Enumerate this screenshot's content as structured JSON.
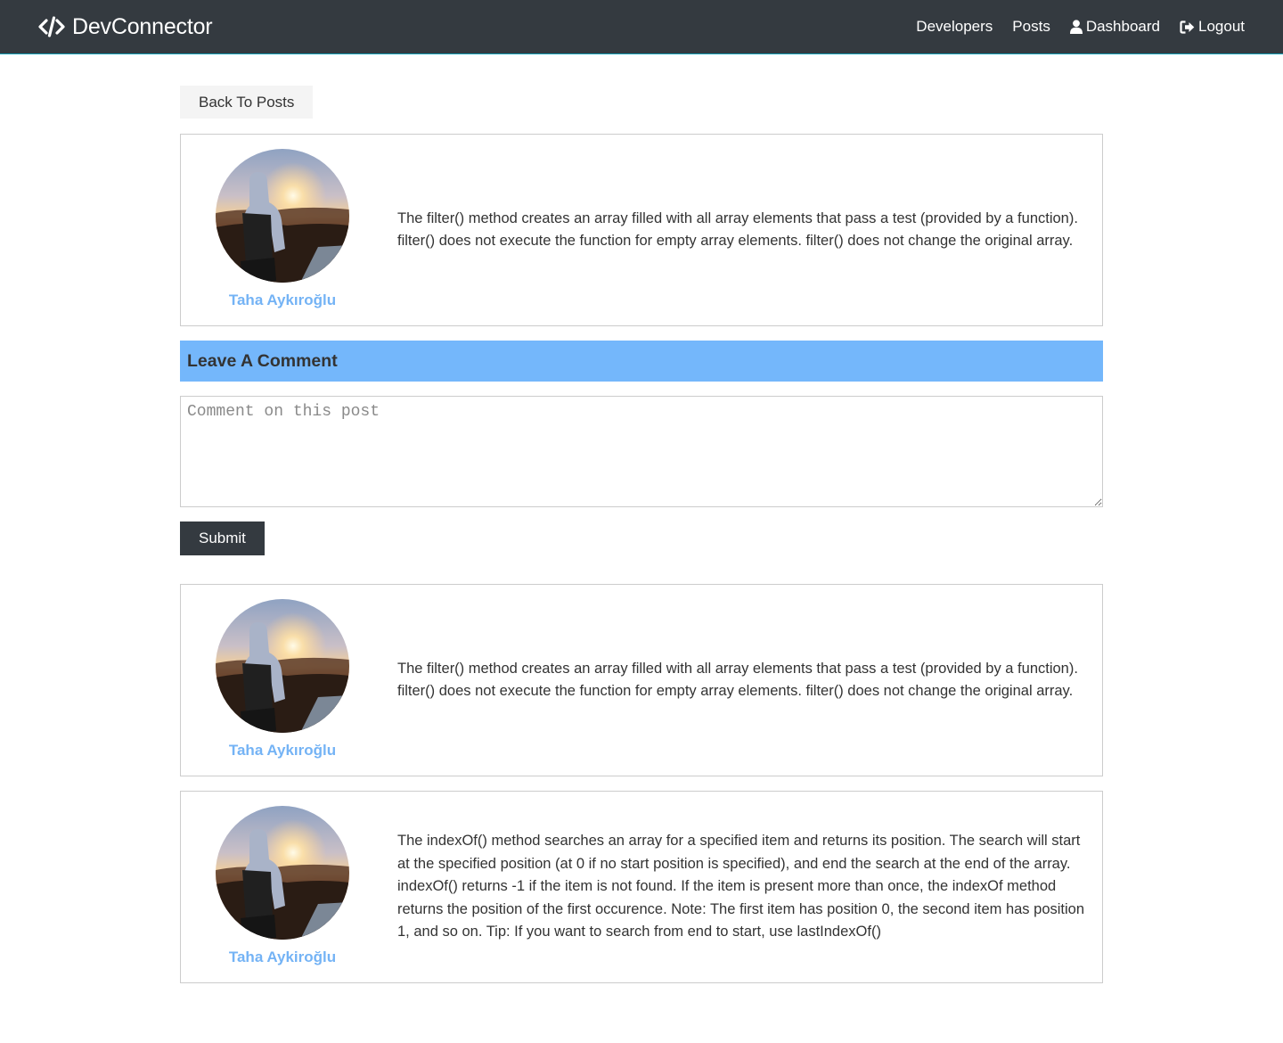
{
  "navbar": {
    "brand": "DevConnector",
    "brand_icon": "code-icon",
    "links": [
      {
        "label": "Developers",
        "icon": ""
      },
      {
        "label": "Posts",
        "icon": ""
      },
      {
        "label": "Dashboard",
        "icon": "user-icon"
      },
      {
        "label": "Logout",
        "icon": "sign-out-icon"
      }
    ]
  },
  "back_button": "Back To Posts",
  "post": {
    "author": "Taha Aykıroğlu",
    "text": "The filter() method creates an array filled with all array elements that pass a test (provided by a function). filter() does not execute the function for empty array elements. filter() does not change the original array."
  },
  "comment_form": {
    "heading": "Leave A Comment",
    "placeholder": "Comment on this post",
    "value": "",
    "submit_label": "Submit"
  },
  "comments": [
    {
      "author": "Taha Aykıroğlu",
      "text": "The filter() method creates an array filled with all array elements that pass a test (provided by a function). filter() does not execute the function for empty array elements. filter() does not change the original array."
    },
    {
      "author": "Taha Aykiroğlu",
      "text": "The indexOf() method searches an array for a specified item and returns its position. The search will start at the specified position (at 0 if no start position is specified), and end the search at the end of the array. indexOf() returns -1 if the item is not found. If the item is present more than once, the indexOf method returns the position of the first occurence. Note: The first item has position 0, the second item has position 1, and so on. Tip: If you want to search from end to start, use lastIndexOf()"
    }
  ],
  "colors": {
    "navbar_bg": "#343a40",
    "primary": "#74b7fb",
    "author_link": "#74b3f5",
    "light_btn": "#f4f4f4",
    "dark_btn": "#343a40"
  }
}
